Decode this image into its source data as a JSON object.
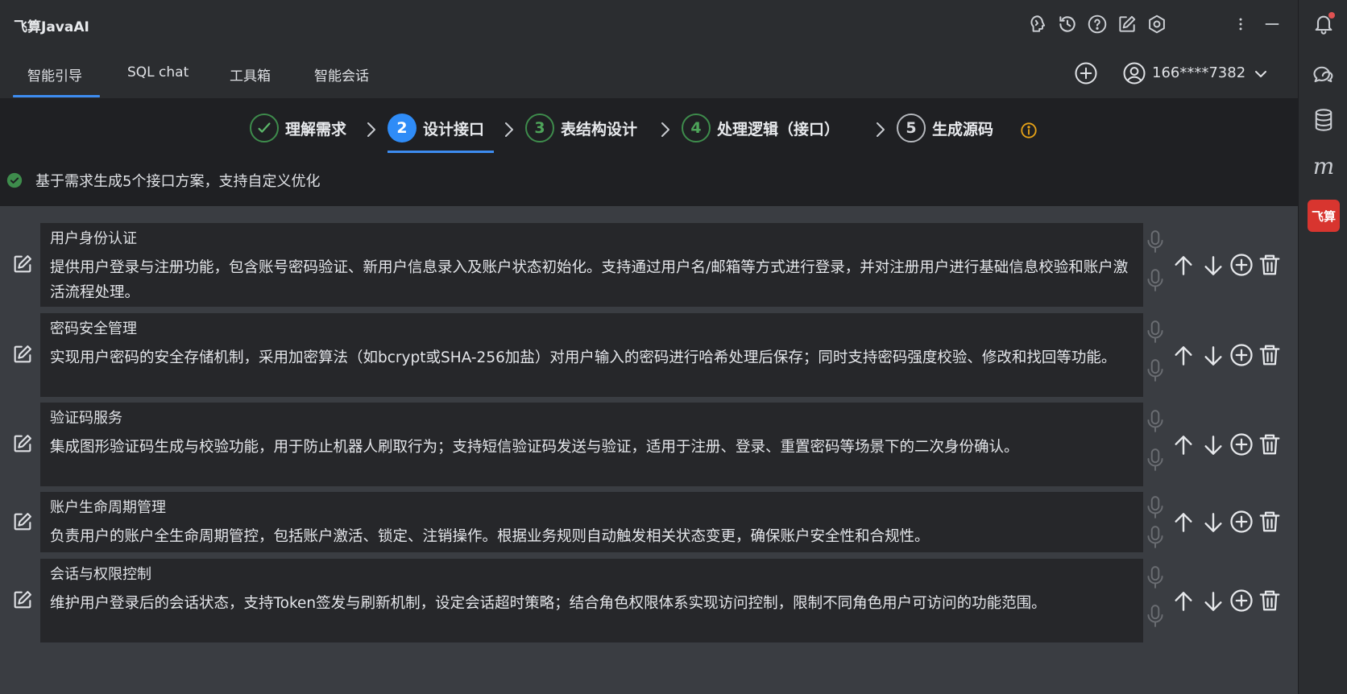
{
  "app": {
    "title": "飞算JavaAI"
  },
  "nav": {
    "tabs": [
      {
        "label": "智能引导",
        "active": true
      },
      {
        "label": "SQL chat",
        "active": false
      },
      {
        "label": "工具箱",
        "active": false
      },
      {
        "label": "智能会话",
        "active": false
      }
    ],
    "user": {
      "phone": "166****7382"
    }
  },
  "titlebar_icons": [
    "brain-icon",
    "history-icon",
    "help-icon",
    "edit-icon",
    "settings-icon",
    "more-icon",
    "minimize-icon"
  ],
  "stepper": {
    "steps": [
      {
        "number": "✓",
        "label": "理解需求",
        "state": "done"
      },
      {
        "number": "2",
        "label": "设计接口",
        "state": "active"
      },
      {
        "number": "3",
        "label": "表结构设计",
        "state": "pending"
      },
      {
        "number": "4",
        "label": "处理逻辑（接口）",
        "state": "pending"
      },
      {
        "number": "5",
        "label": "生成源码",
        "state": "pending"
      }
    ]
  },
  "status": {
    "text": "基于需求生成5个接口方案，支持自定义优化"
  },
  "items": [
    {
      "title": "用户身份认证",
      "description": "提供用户登录与注册功能，包含账号密码验证、新用户信息录入及账户状态初始化。支持通过用户名/邮箱等方式进行登录，并对注册用户进行基础信息校验和账户激活流程处理。"
    },
    {
      "title": "密码安全管理",
      "description": "实现用户密码的安全存储机制，采用加密算法（如bcrypt或SHA-256加盐）对用户输入的密码进行哈希处理后保存；同时支持密码强度校验、修改和找回等功能。"
    },
    {
      "title": "验证码服务",
      "description": "集成图形验证码生成与校验功能，用于防止机器人刷取行为；支持短信验证码发送与验证，适用于注册、登录、重置密码等场景下的二次身份确认。"
    },
    {
      "title": "账户生命周期管理",
      "description": "负责用户的账户全生命周期管控，包括账户激活、锁定、注销操作。根据业务规则自动触发相关状态变更，确保账户安全性和合规性。"
    },
    {
      "title": "会话与权限控制",
      "description": "维护用户登录后的会话状态，支持Token签发与刷新机制，设定会话超时策略；结合角色权限体系实现访问控制，限制不同角色用户可访问的功能范围。"
    }
  ],
  "right_strip": {
    "icons": [
      "bell-icon",
      "chat-icon",
      "database-icon",
      "m-icon",
      "brand-icon"
    ],
    "m_label": "m",
    "brand_label": "飞算"
  },
  "colors": {
    "accent": "#3d8cf0",
    "success": "#3e8c4c",
    "warning": "#e8a317",
    "brand": "#d8352f"
  }
}
